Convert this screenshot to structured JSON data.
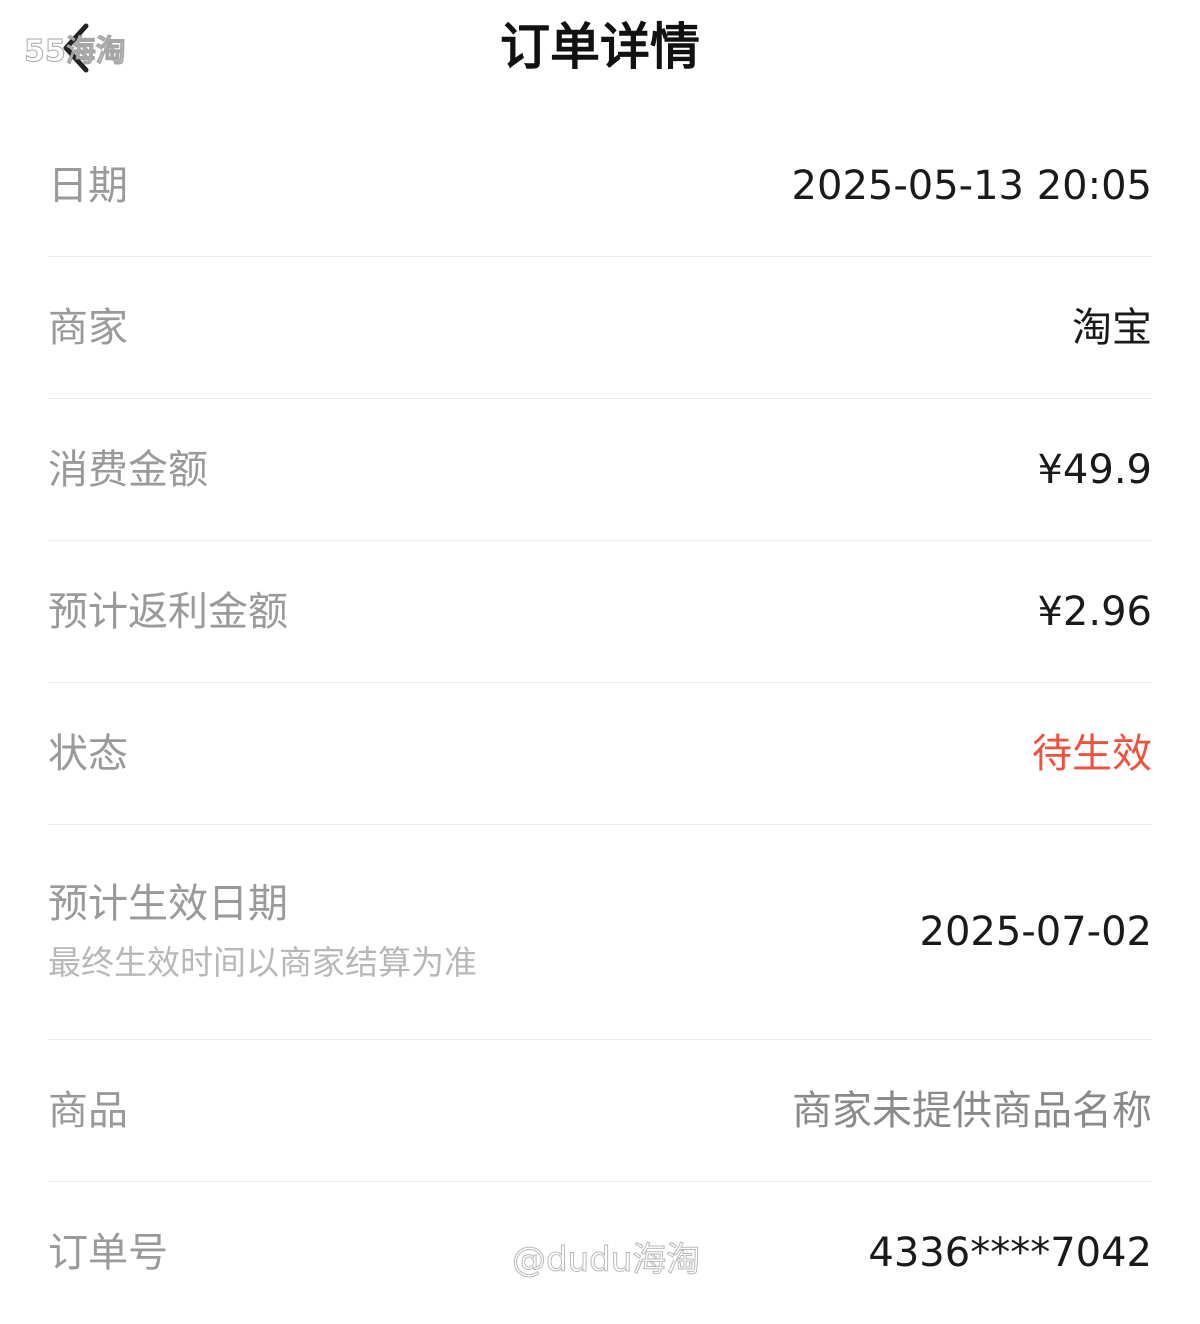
{
  "header": {
    "title": "订单详情",
    "back_icon": "chevron-left-icon"
  },
  "watermarks": {
    "top_left": "55海淘",
    "bottom": "@dudu海淘"
  },
  "details": [
    {
      "label": "日期",
      "value": "2025-05-13 20:05"
    },
    {
      "label": "商家",
      "value": "淘宝"
    },
    {
      "label": "消费金额",
      "value": "¥49.9"
    },
    {
      "label": "预计返利金额",
      "value": "¥2.96"
    },
    {
      "label": "状态",
      "value": "待生效"
    },
    {
      "label": "预计生效日期",
      "sublabel": "最终生效时间以商家结算为准",
      "value": "2025-07-02"
    },
    {
      "label": "商品",
      "value": "商家未提供商品名称"
    },
    {
      "label": "订单号",
      "value": "4336****7042"
    }
  ],
  "colors": {
    "status": "#f0513f",
    "label": "#9a9a9a",
    "value": "#1a1a1a",
    "divider": "#ececec"
  }
}
